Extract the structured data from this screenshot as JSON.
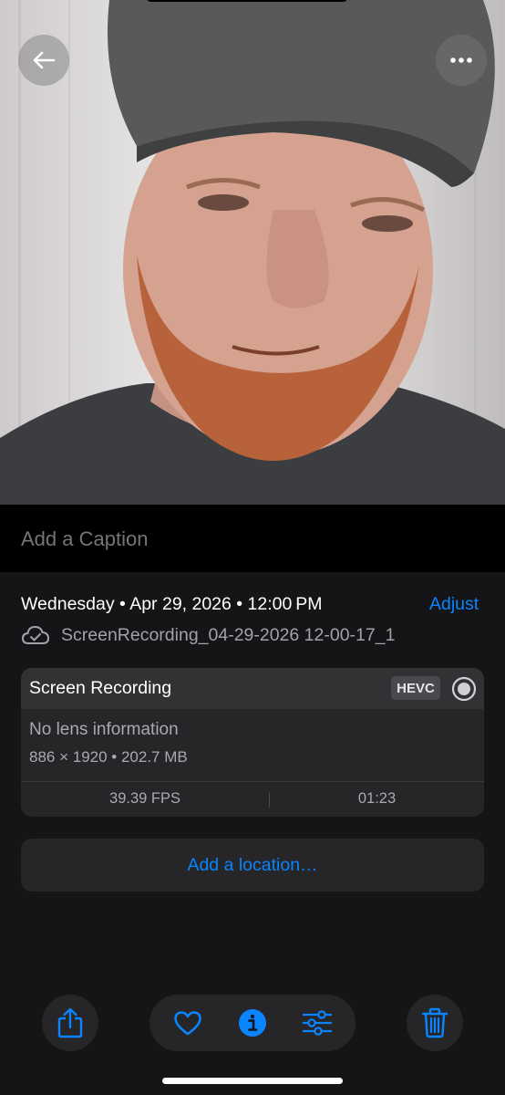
{
  "caption": {
    "placeholder": "Add a Caption"
  },
  "details": {
    "date": "Wednesday • Apr 29, 2026 • 12:00 PM",
    "adjust_label": "Adjust",
    "filename": "ScreenRecording_04-29-2026 12-00-17_1"
  },
  "card": {
    "title": "Screen Recording",
    "codec_badge": "HEVC",
    "lens": "No lens information",
    "dimensions": "886 × 1920 • 202.7 MB",
    "fps": "39.39 FPS",
    "duration": "01:23"
  },
  "location": {
    "label": "Add a location…"
  },
  "icons": {
    "back": "arrow-left-icon",
    "more": "ellipsis-icon",
    "cloud": "icloud-check-icon",
    "record": "screen-record-icon",
    "share": "share-icon",
    "heart": "heart-icon",
    "info": "info-icon",
    "edit": "sliders-icon",
    "trash": "trash-icon"
  },
  "colors": {
    "accent": "#0a84ff",
    "background": "#151517",
    "card": "#262628"
  }
}
